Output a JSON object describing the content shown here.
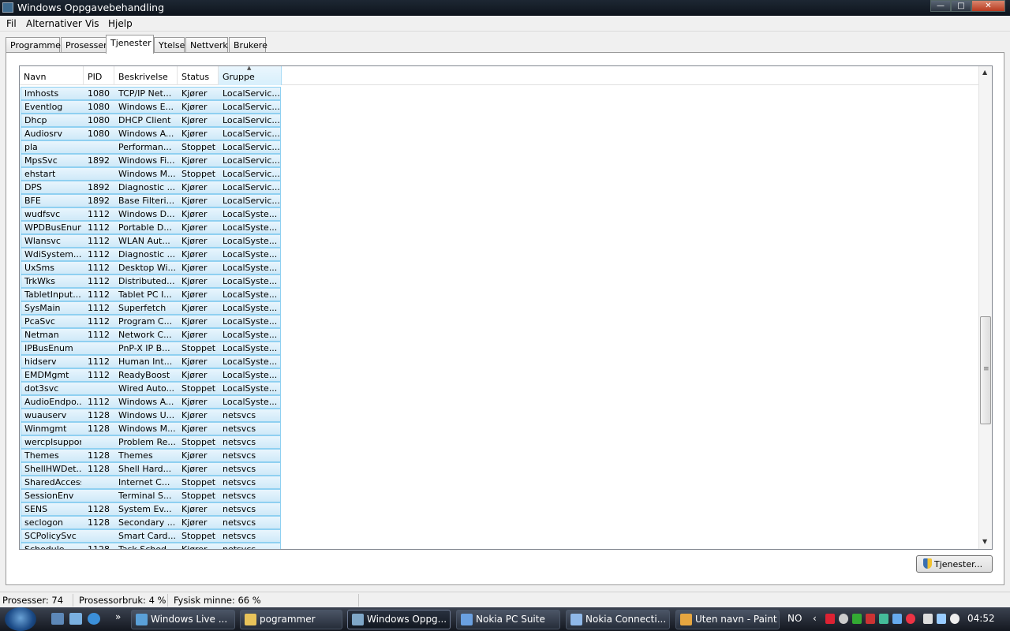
{
  "window": {
    "title": "Windows Oppgavebehandling",
    "controls": [
      "minimize",
      "maximize",
      "close"
    ]
  },
  "menu": [
    "Fil",
    "Alternativer",
    "Vis",
    "Hjelp"
  ],
  "tabs": [
    "Programmer",
    "Prosesser",
    "Tjenester",
    "Ytelse",
    "Nettverk",
    "Brukere"
  ],
  "active_tab": "Tjenester",
  "columns": {
    "name": "Navn",
    "pid": "PID",
    "desc": "Beskrivelse",
    "status": "Status",
    "group": "Gruppe"
  },
  "services": [
    {
      "name": "lmhosts",
      "pid": "1080",
      "desc": "TCP/IP Net...",
      "status": "Kjører",
      "group": "LocalServic..."
    },
    {
      "name": "Eventlog",
      "pid": "1080",
      "desc": "Windows E...",
      "status": "Kjører",
      "group": "LocalServic..."
    },
    {
      "name": "Dhcp",
      "pid": "1080",
      "desc": "DHCP Client",
      "status": "Kjører",
      "group": "LocalServic..."
    },
    {
      "name": "Audiosrv",
      "pid": "1080",
      "desc": "Windows A...",
      "status": "Kjører",
      "group": "LocalServic..."
    },
    {
      "name": "pla",
      "pid": "",
      "desc": "Performan...",
      "status": "Stoppet",
      "group": "LocalServic..."
    },
    {
      "name": "MpsSvc",
      "pid": "1892",
      "desc": "Windows Fi...",
      "status": "Kjører",
      "group": "LocalServic..."
    },
    {
      "name": "ehstart",
      "pid": "",
      "desc": "Windows M...",
      "status": "Stoppet",
      "group": "LocalServic..."
    },
    {
      "name": "DPS",
      "pid": "1892",
      "desc": "Diagnostic ...",
      "status": "Kjører",
      "group": "LocalServic..."
    },
    {
      "name": "BFE",
      "pid": "1892",
      "desc": "Base Filteri...",
      "status": "Kjører",
      "group": "LocalServic..."
    },
    {
      "name": "wudfsvc",
      "pid": "1112",
      "desc": "Windows D...",
      "status": "Kjører",
      "group": "LocalSyste..."
    },
    {
      "name": "WPDBusEnum",
      "pid": "1112",
      "desc": "Portable D...",
      "status": "Kjører",
      "group": "LocalSyste..."
    },
    {
      "name": "Wlansvc",
      "pid": "1112",
      "desc": "WLAN Aut...",
      "status": "Kjører",
      "group": "LocalSyste..."
    },
    {
      "name": "WdiSystem...",
      "pid": "1112",
      "desc": "Diagnostic ...",
      "status": "Kjører",
      "group": "LocalSyste..."
    },
    {
      "name": "UxSms",
      "pid": "1112",
      "desc": "Desktop Wi...",
      "status": "Kjører",
      "group": "LocalSyste..."
    },
    {
      "name": "TrkWks",
      "pid": "1112",
      "desc": "Distributed...",
      "status": "Kjører",
      "group": "LocalSyste..."
    },
    {
      "name": "TabletInput...",
      "pid": "1112",
      "desc": "Tablet PC I...",
      "status": "Kjører",
      "group": "LocalSyste..."
    },
    {
      "name": "SysMain",
      "pid": "1112",
      "desc": "Superfetch",
      "status": "Kjører",
      "group": "LocalSyste..."
    },
    {
      "name": "PcaSvc",
      "pid": "1112",
      "desc": "Program C...",
      "status": "Kjører",
      "group": "LocalSyste..."
    },
    {
      "name": "Netman",
      "pid": "1112",
      "desc": "Network C...",
      "status": "Kjører",
      "group": "LocalSyste..."
    },
    {
      "name": "IPBusEnum",
      "pid": "",
      "desc": "PnP-X IP B...",
      "status": "Stoppet",
      "group": "LocalSyste..."
    },
    {
      "name": "hidserv",
      "pid": "1112",
      "desc": "Human Int...",
      "status": "Kjører",
      "group": "LocalSyste..."
    },
    {
      "name": "EMDMgmt",
      "pid": "1112",
      "desc": "ReadyBoost",
      "status": "Kjører",
      "group": "LocalSyste..."
    },
    {
      "name": "dot3svc",
      "pid": "",
      "desc": "Wired Auto...",
      "status": "Stoppet",
      "group": "LocalSyste..."
    },
    {
      "name": "AudioEndpo...",
      "pid": "1112",
      "desc": "Windows A...",
      "status": "Kjører",
      "group": "LocalSyste..."
    },
    {
      "name": "wuauserv",
      "pid": "1128",
      "desc": "Windows U...",
      "status": "Kjører",
      "group": "netsvcs"
    },
    {
      "name": "Winmgmt",
      "pid": "1128",
      "desc": "Windows M...",
      "status": "Kjører",
      "group": "netsvcs"
    },
    {
      "name": "wercplsupport",
      "pid": "",
      "desc": "Problem Re...",
      "status": "Stoppet",
      "group": "netsvcs"
    },
    {
      "name": "Themes",
      "pid": "1128",
      "desc": "Themes",
      "status": "Kjører",
      "group": "netsvcs"
    },
    {
      "name": "ShellHWDet...",
      "pid": "1128",
      "desc": "Shell Hard...",
      "status": "Kjører",
      "group": "netsvcs"
    },
    {
      "name": "SharedAccess",
      "pid": "",
      "desc": "Internet C...",
      "status": "Stoppet",
      "group": "netsvcs"
    },
    {
      "name": "SessionEnv",
      "pid": "",
      "desc": "Terminal S...",
      "status": "Stoppet",
      "group": "netsvcs"
    },
    {
      "name": "SENS",
      "pid": "1128",
      "desc": "System Ev...",
      "status": "Kjører",
      "group": "netsvcs"
    },
    {
      "name": "seclogon",
      "pid": "1128",
      "desc": "Secondary ...",
      "status": "Kjører",
      "group": "netsvcs"
    },
    {
      "name": "SCPolicySvc",
      "pid": "",
      "desc": "Smart Card...",
      "status": "Stoppet",
      "group": "netsvcs"
    },
    {
      "name": "Schedule",
      "pid": "1128",
      "desc": "Task Sched...",
      "status": "Kjører",
      "group": "netsvcs"
    }
  ],
  "services_button": "Tjenester...",
  "statusbar": {
    "processes": "Prosesser: 74",
    "cpu": "Prosessorbruk: 4 %",
    "memory": "Fysisk minne: 66 %"
  },
  "taskbar": {
    "buttons": [
      {
        "label": "Windows Live ...",
        "icon": "messenger-icon",
        "color": "#5aa0d8"
      },
      {
        "label": "pogrammer",
        "icon": "folder-icon",
        "color": "#e8c35a"
      },
      {
        "label": "Windows Oppg...",
        "icon": "task-manager-icon",
        "color": "#7fa7c8",
        "active": true
      },
      {
        "label": "Nokia PC Suite",
        "icon": "nokia-suite-icon",
        "color": "#6aa0e0"
      },
      {
        "label": "Nokia Connecti...",
        "icon": "nokia-connect-icon",
        "color": "#8fb8e8"
      },
      {
        "label": "Uten navn - Paint",
        "icon": "paint-icon",
        "color": "#e6a640"
      }
    ],
    "language": "NO",
    "clock": "04:52"
  },
  "colors": {
    "selection_bg": "#cfe9f8",
    "selection_border": "#8fd0f1",
    "taskbar": "#1f2530"
  }
}
